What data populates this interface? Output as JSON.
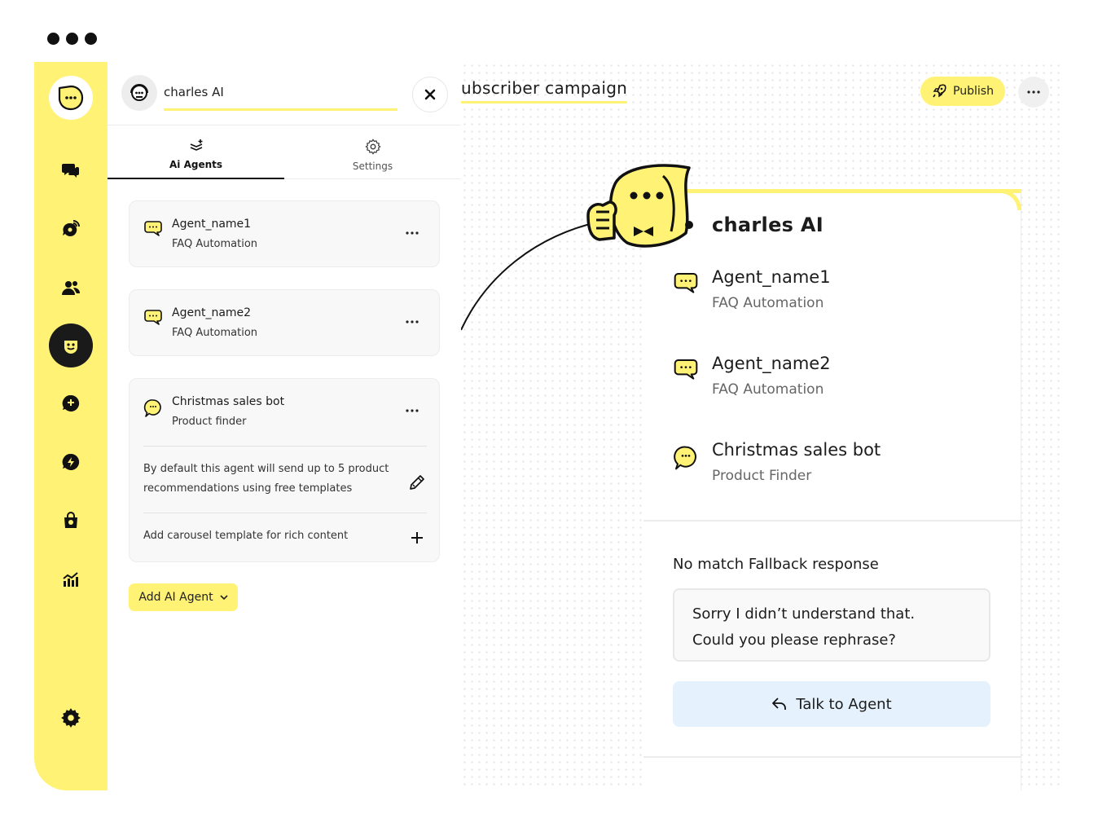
{
  "panel": {
    "bot_name_value": "charles AI",
    "tabs": [
      {
        "label": "Ai Agents",
        "icon": "agents-stack-icon"
      },
      {
        "label": "Settings",
        "icon": "gear-icon"
      }
    ],
    "agents": [
      {
        "name": "Agent_name1",
        "type": "FAQ Automation"
      },
      {
        "name": "Agent_name2",
        "type": "FAQ Automation"
      },
      {
        "name": "Christmas sales bot",
        "type": "Product finder",
        "description": "By default this agent will send up to 5 product recommendations using free templates",
        "add_action": "Add carousel template for rich content"
      }
    ],
    "add_agent_label": "Add AI Agent"
  },
  "canvas": {
    "campaign_title": "ubscriber campaign",
    "publish_label": "Publish",
    "node": {
      "title": "charles AI",
      "agents": [
        {
          "name": "Agent_name1",
          "type": "FAQ Automation"
        },
        {
          "name": "Agent_name2",
          "type": "FAQ Automation"
        },
        {
          "name": "Christmas sales bot",
          "type": "Product Finder"
        }
      ],
      "fallback_label": "No match Fallback response",
      "fallback_line1": "Sorry I didn’t understand that.",
      "fallback_line2": "Could you please rephrase?",
      "talk_label": "Talk to Agent"
    }
  },
  "colors": {
    "brand_yellow": "#fff275",
    "dark": "#1a1a1a",
    "talk_button_bg": "#e5f1fd"
  }
}
